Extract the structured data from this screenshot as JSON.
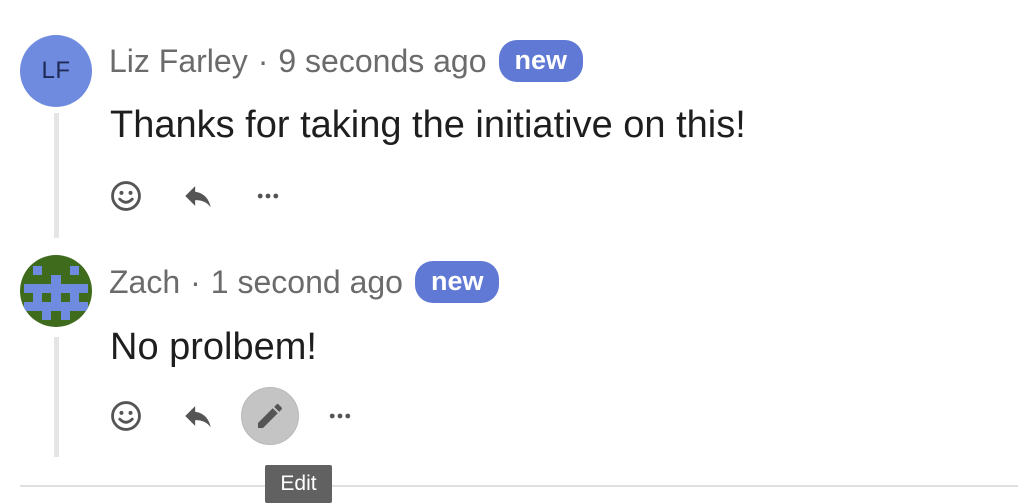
{
  "comments": [
    {
      "author": "Liz Farley",
      "separator": "·",
      "time": "9 seconds ago",
      "badge": "new",
      "text": "Thanks for taking the initiative on this!",
      "avatar": {
        "type": "initials",
        "initials": "LF",
        "color": "#6f8be0"
      },
      "actions": [
        "emoji-icon",
        "reply-icon",
        "more-icon"
      ]
    },
    {
      "author": "Zach",
      "separator": "·",
      "time": "1 second ago",
      "badge": "new",
      "text": "No prolbem!",
      "avatar": {
        "type": "pixel-identicon",
        "background": "#3f6b1c",
        "foreground": "#6f8be0"
      },
      "actions": [
        "emoji-icon",
        "reply-icon",
        "edit-icon",
        "more-icon"
      ]
    }
  ],
  "tooltip": {
    "text": "Edit"
  },
  "colors": {
    "badge": "#5f79d4",
    "meta_text": "#6b6b6b",
    "body_text": "#1e1e1e",
    "edit_hover": "#c4c4c4",
    "tooltip_bg": "#616161"
  }
}
